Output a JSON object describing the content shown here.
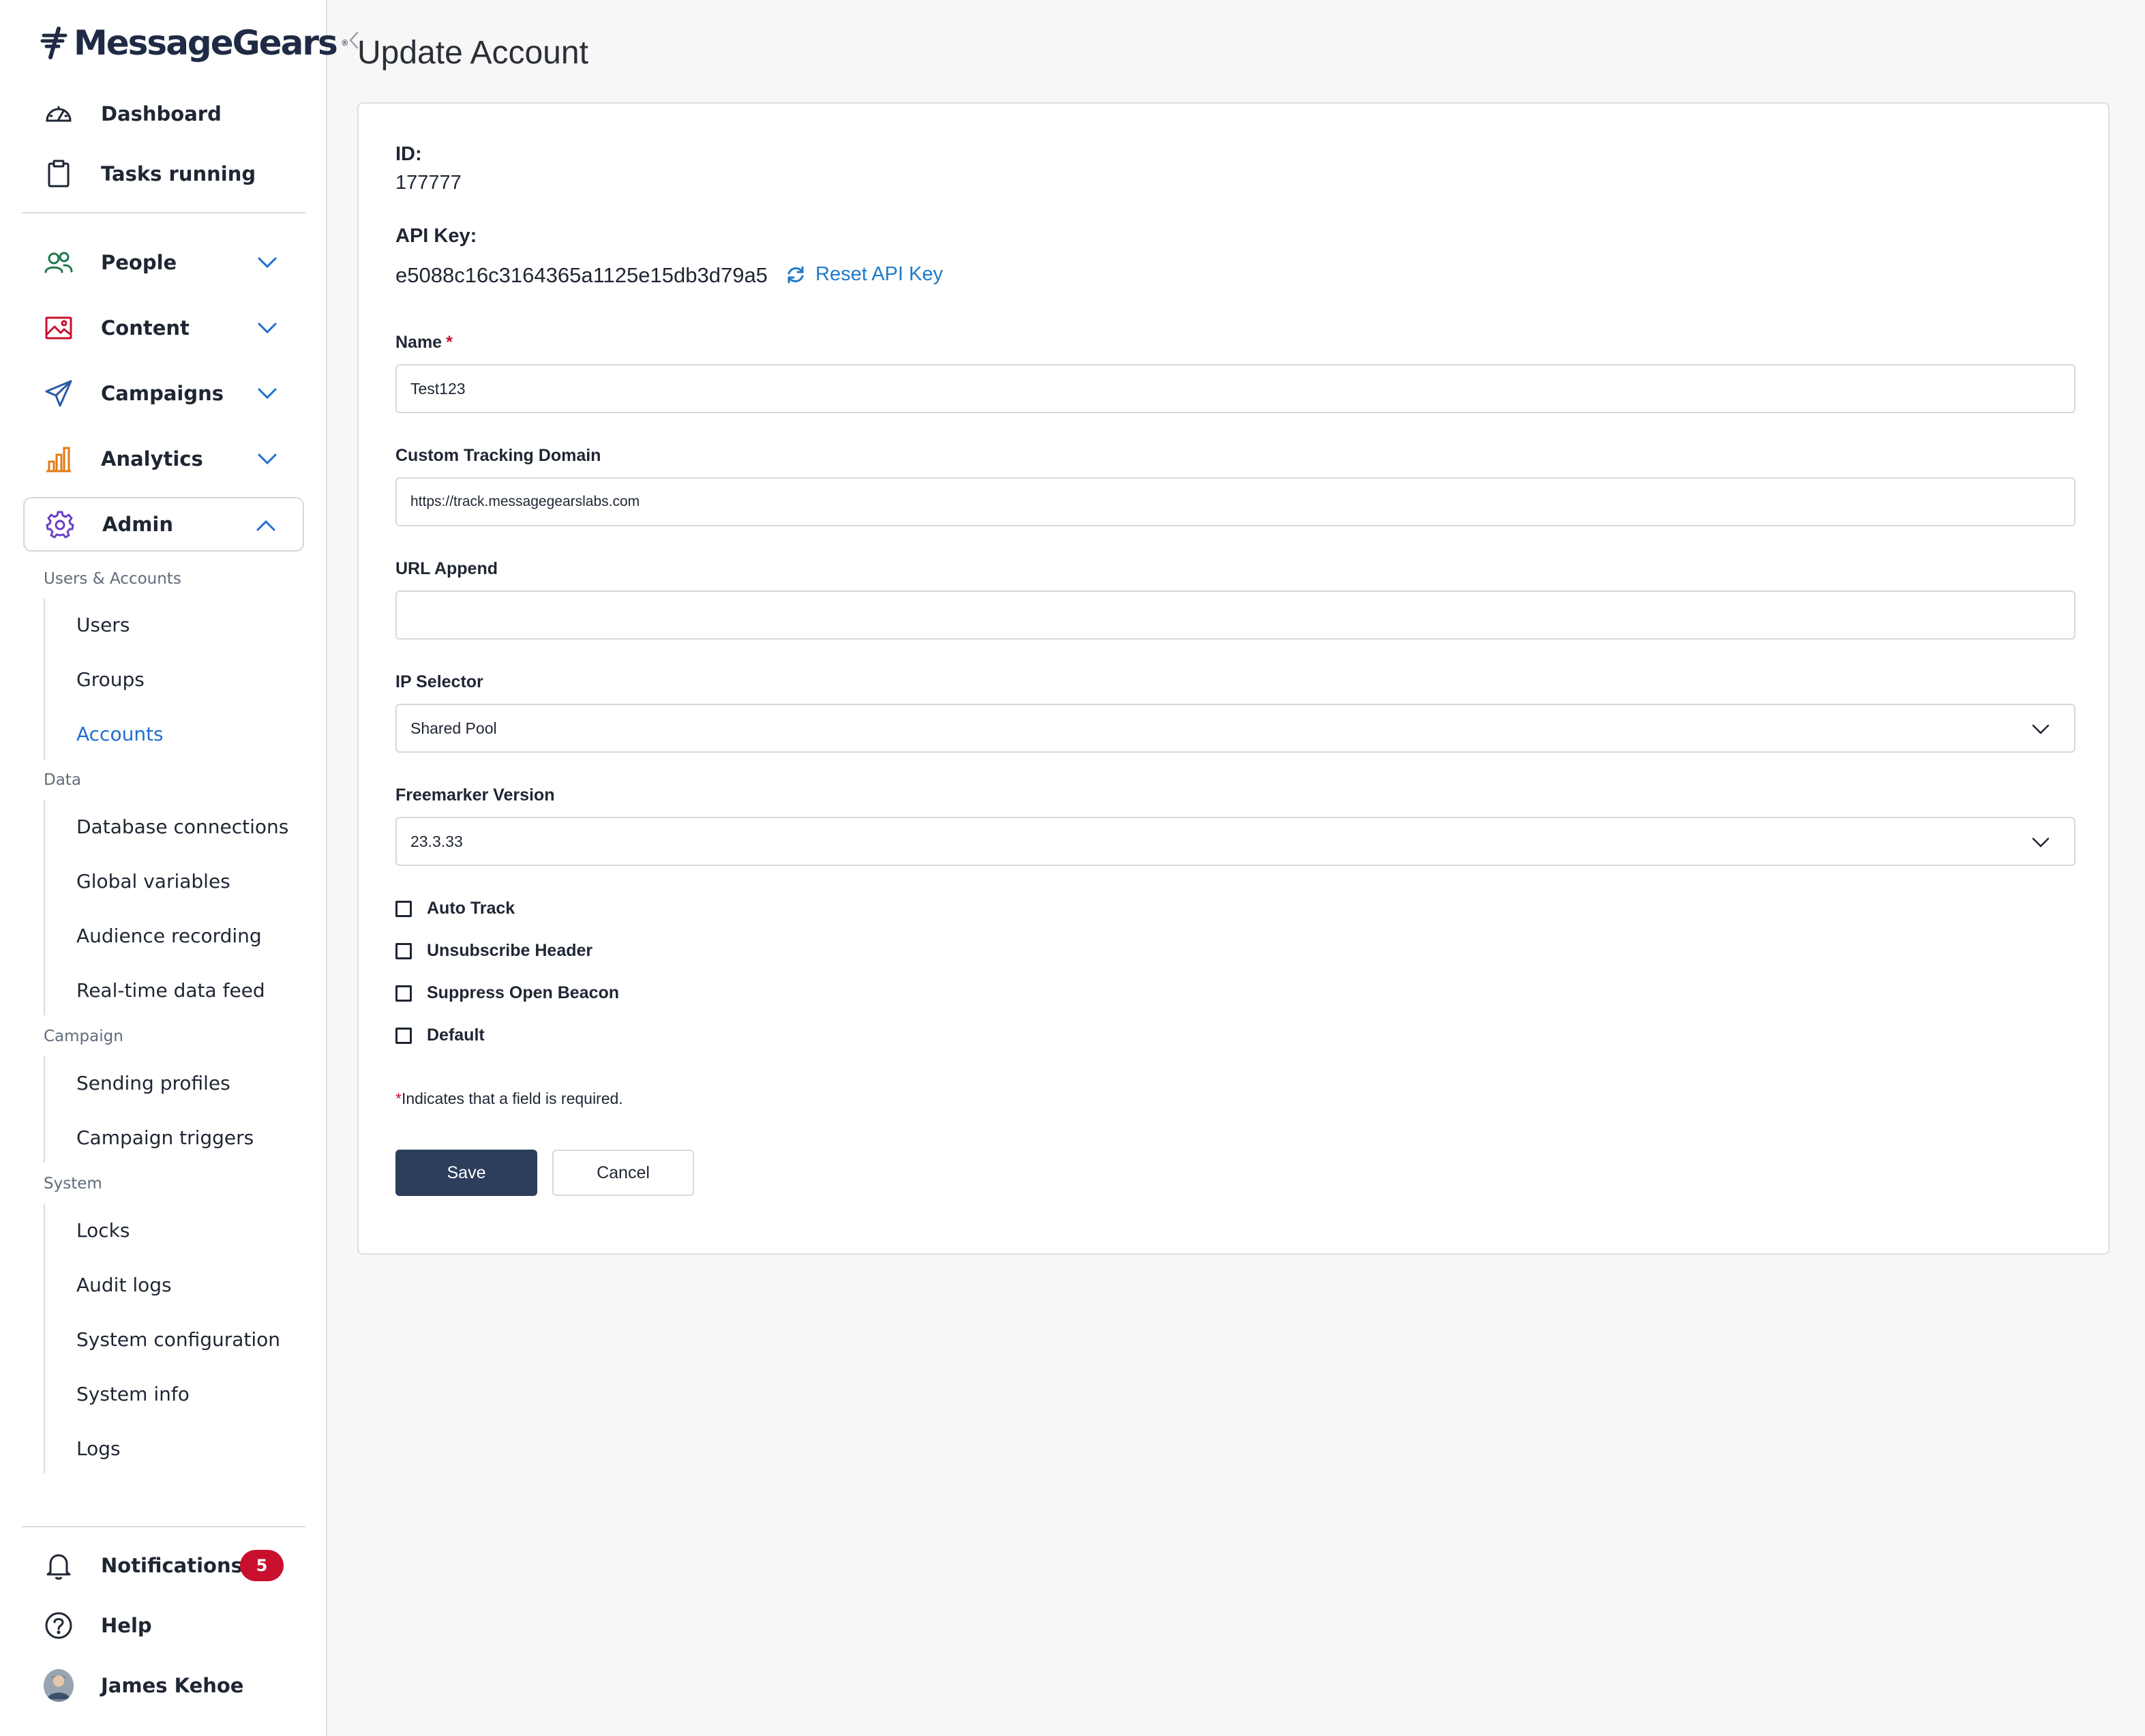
{
  "brand": {
    "name": "MessageGears",
    "trademark": "®"
  },
  "nav": {
    "dashboard": "Dashboard",
    "tasks": "Tasks running",
    "people": "People",
    "content": "Content",
    "campaigns": "Campaigns",
    "analytics": "Analytics",
    "admin": "Admin"
  },
  "admin_menu": {
    "users_accounts_label": "Users & Accounts",
    "users": "Users",
    "groups": "Groups",
    "accounts": "Accounts",
    "data_label": "Data",
    "database_connections": "Database connections",
    "global_variables": "Global variables",
    "audience_recording": "Audience recording",
    "realtime_feed": "Real-time data feed",
    "campaign_label": "Campaign",
    "sending_profiles": "Sending profiles",
    "campaign_triggers": "Campaign triggers",
    "system_label": "System",
    "locks": "Locks",
    "audit_logs": "Audit logs",
    "system_configuration": "System configuration",
    "system_info": "System info",
    "logs": "Logs"
  },
  "footer": {
    "notifications": "Notifications",
    "notifications_count": "5",
    "help": "Help",
    "user_name": "James Kehoe"
  },
  "colors": {
    "accent": "#1f6fd0",
    "primary_button": "#2d3e5c",
    "badge": "#c8102e",
    "people_icon": "#1e7a4c",
    "content_icon": "#c8102e",
    "campaigns_icon": "#2b5aa8",
    "analytics_icon": "#e07b16",
    "admin_icon": "#6b3fc9"
  },
  "page": {
    "title": "Update Account",
    "id_label": "ID:",
    "id_value": "177777",
    "api_key_label": "API Key:",
    "api_key_value": "e5088c16c3164365a1125e15db3d79a5",
    "reset_api_key": "Reset API Key"
  },
  "form": {
    "name_label": "Name",
    "required_mark": "*",
    "name_value": "Test123",
    "tracking_label": "Custom Tracking Domain",
    "tracking_value": "https://track.messagegearslabs.com",
    "url_append_label": "URL Append",
    "url_append_value": "",
    "ip_selector_label": "IP Selector",
    "ip_selector_value": "Shared Pool",
    "freemarker_label": "Freemarker Version",
    "freemarker_value": "23.3.33",
    "auto_track": "Auto Track",
    "unsubscribe_header": "Unsubscribe Header",
    "suppress_open_beacon": "Suppress Open Beacon",
    "default": "Default",
    "required_note": "Indicates that a field is required.",
    "save": "Save",
    "cancel": "Cancel"
  }
}
